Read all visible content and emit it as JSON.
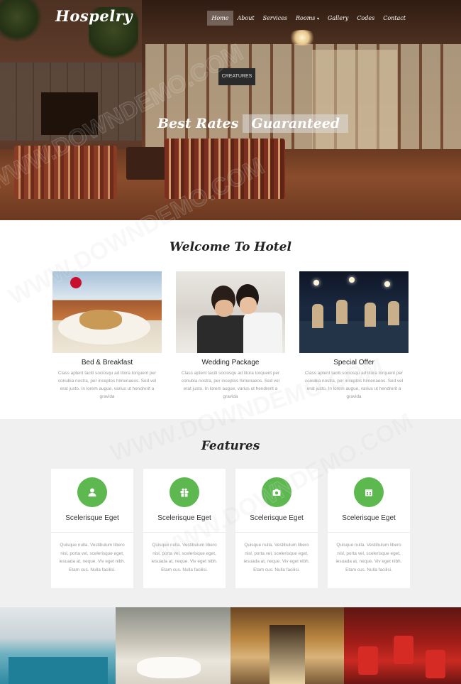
{
  "brand": "Hospelry",
  "nav": {
    "items": [
      "Home",
      "About",
      "Services",
      "Rooms",
      "Gallery",
      "Codes",
      "Contact"
    ]
  },
  "hero": {
    "heading_plain": "Best Rates",
    "heading_highlight": "Guaranteed",
    "sign": "CREATURES"
  },
  "welcome": {
    "title": "Welcome To Hotel",
    "cards": [
      {
        "title": "Bed & Breakfast",
        "text": "Class aptent taciti sociosqu ad litora torquent per conubia nostra, per inceptos himenaeos. Sed vel erat justo. In lorem augue, varius ut hendrerit a gravida"
      },
      {
        "title": "Wedding Package",
        "text": "Class aptent taciti sociosqu ad litora torquent per conubia nostra, per inceptos himenaeos. Sed vel erat justo. In lorem augue, varius ut hendrerit a gravida"
      },
      {
        "title": "Special Offer",
        "text": "Class aptent taciti sociosqu ad litora torquent per conubia nostra, per inceptos himenaeos. Sed vel erat justo. In lorem augue, varius ut hendrerit a gravida"
      }
    ]
  },
  "features": {
    "title": "Features",
    "accent_color": "#5cb84f",
    "cards": [
      {
        "icon": "user-icon",
        "title": "Scelerisque Eget",
        "text": "Quisque nulla. Vestibulum libero nisl, porta vel, scelerisque eget, iesuada at, neque. Viv eget nibh. Etam cus. Nulla facilisi."
      },
      {
        "icon": "gift-icon",
        "title": "Scelerisque Eget",
        "text": "Quisque nulla. Vestibulum libero nisl, porta vel, scelerisque eget, iesuada at, neque. Viv eget nibh. Etam cus. Nulla facilisi."
      },
      {
        "icon": "camera-icon",
        "title": "Scelerisque Eget",
        "text": "Quisque nulla. Vestibulum libero nisl, porta vel, scelerisque eget, iesuada at, neque. Viv eget nibh. Etam cus. Nulla facilisi."
      },
      {
        "icon": "calendar-icon",
        "title": "Scelerisque Eget",
        "text": "Quisque nulla. Vestibulum libero nisl, porta vel, scelerisque eget, iesuada at, neque. Viv eget nibh. Etam cus. Nulla facilisi."
      }
    ]
  },
  "gallery": {
    "images": [
      "pool-photo",
      "bathroom-photo",
      "corridor-photo",
      "restaurant-photo"
    ]
  },
  "watermark": "WWW.DOWNDEMO.COM"
}
